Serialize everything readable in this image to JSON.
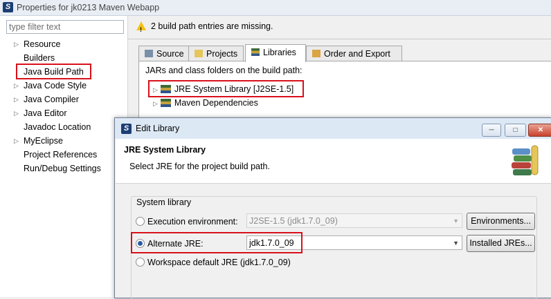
{
  "window": {
    "title": "Properties for jk0213 Maven Webapp"
  },
  "left_pane": {
    "filter_placeholder": "type filter text",
    "items": [
      {
        "label": "Resource",
        "expandable": true
      },
      {
        "label": "Builders",
        "expandable": false
      },
      {
        "label": "Java Build Path",
        "expandable": false,
        "selected": true
      },
      {
        "label": "Java Code Style",
        "expandable": true
      },
      {
        "label": "Java Compiler",
        "expandable": true
      },
      {
        "label": "Java Editor",
        "expandable": true
      },
      {
        "label": "Javadoc Location",
        "expandable": false
      },
      {
        "label": "MyEclipse",
        "expandable": true
      },
      {
        "label": "Project References",
        "expandable": false
      },
      {
        "label": "Run/Debug Settings",
        "expandable": false
      }
    ]
  },
  "main": {
    "warning": "2 build path entries are missing.",
    "tabs": [
      {
        "label": "Source",
        "icon": "source-icon"
      },
      {
        "label": "Projects",
        "icon": "folder-icon"
      },
      {
        "label": "Libraries",
        "icon": "books-icon",
        "active": true
      },
      {
        "label": "Order and Export",
        "icon": "order-icon"
      }
    ],
    "panel_label": "JARs and class folders on the build path:",
    "libraries": [
      {
        "label": "JRE System Library [J2SE-1.5]",
        "highlighted": true
      },
      {
        "label": "Maven Dependencies"
      }
    ]
  },
  "dialog": {
    "title": "Edit Library",
    "header_title": "JRE System Library",
    "header_desc": "Select JRE for the project build path.",
    "group_label": "System library",
    "exec_env_label": "Execution environment:",
    "exec_env_value": "J2SE-1.5 (jdk1.7.0_09)",
    "environments_button": "Environments...",
    "alt_jre_label": "Alternate JRE:",
    "alt_jre_value": "jdk1.7.0_09",
    "installed_jres_button": "Installed JREs...",
    "workspace_default_label": "Workspace default JRE (jdk1.7.0_09)",
    "selected_option": "Alternate JRE"
  },
  "colors": {
    "highlight_box": "#d8101a",
    "warning": "#f4c21a"
  }
}
